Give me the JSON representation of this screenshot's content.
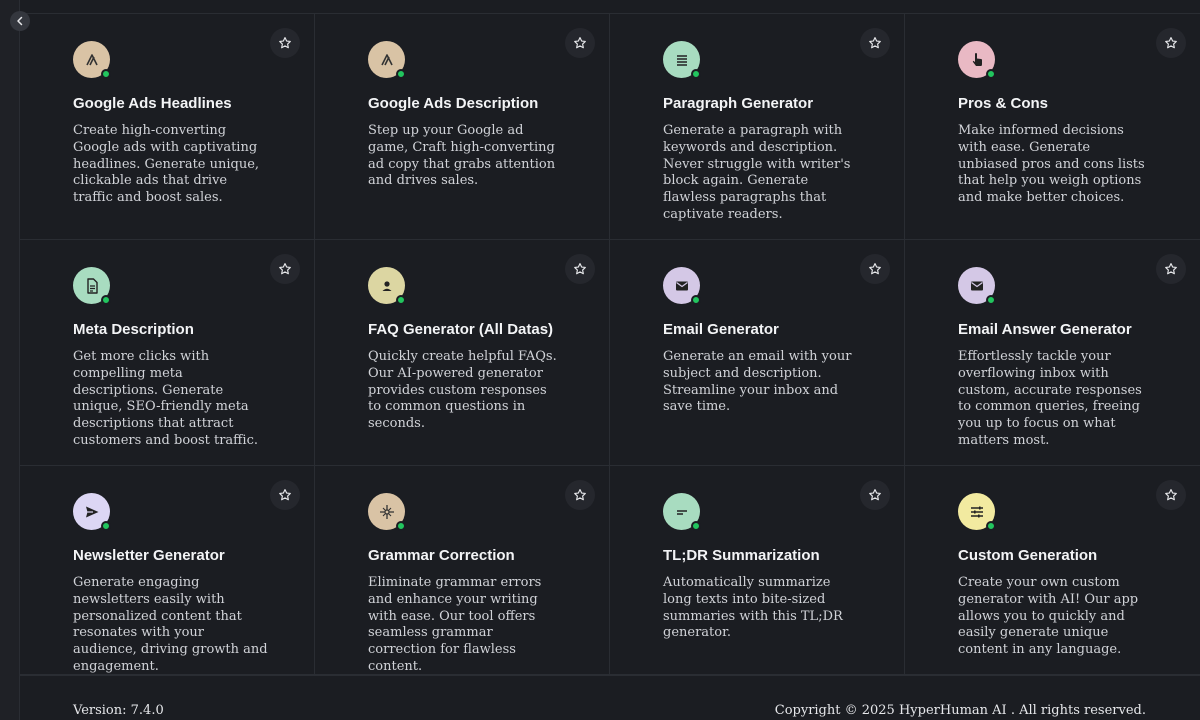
{
  "cards": [
    {
      "title": "Google Ads Headlines",
      "description": "Create high-converting Google ads with captivating headlines. Generate unique, clickable ads that drive traffic and boost sales.",
      "icon": "google-ads-icon",
      "icon_bg": "#d9c3a5"
    },
    {
      "title": "Google Ads Description",
      "description": "Step up your Google ad game, Craft high-converting ad copy that grabs attention and drives sales.",
      "icon": "google-ads-icon",
      "icon_bg": "#d9c3a5"
    },
    {
      "title": "Paragraph Generator",
      "description": "Generate a paragraph with keywords and description. Never struggle with writer's block again. Generate flawless paragraphs that captivate readers.",
      "icon": "paragraph-icon",
      "icon_bg": "#a8dcc0"
    },
    {
      "title": "Pros & Cons",
      "description": "Make informed decisions with ease. Generate unbiased pros and cons lists that help you weigh options and make better choices.",
      "icon": "pointer-hand-icon",
      "icon_bg": "#e9b9c4"
    },
    {
      "title": "Meta Description",
      "description": "Get more clicks with compelling meta descriptions. Generate unique, SEO-friendly meta descriptions that attract customers and boost traffic.",
      "icon": "document-icon",
      "icon_bg": "#a8dcc0"
    },
    {
      "title": "FAQ Generator (All Datas)",
      "description": "Quickly create helpful FAQs. Our AI-powered generator provides custom responses to common questions in seconds.",
      "icon": "person-icon",
      "icon_bg": "#dcd6a2"
    },
    {
      "title": "Email Generator",
      "description": "Generate an email with your subject and description. Streamline your inbox and save time.",
      "icon": "mail-icon",
      "icon_bg": "#d4c8e6"
    },
    {
      "title": "Email Answer Generator",
      "description": "Effortlessly tackle your overflowing inbox with custom, accurate responses to common queries, freeing you up to focus on what matters most.",
      "icon": "mail-icon",
      "icon_bg": "#d4c8e6"
    },
    {
      "title": "Newsletter Generator",
      "description": "Generate engaging newsletters easily with personalized content that resonates with your audience, driving growth and engagement.",
      "icon": "send-icon",
      "icon_bg": "#dcd6f4"
    },
    {
      "title": "Grammar Correction",
      "description": "Eliminate grammar errors and enhance your writing with ease. Our tool offers seamless grammar correction for flawless content.",
      "icon": "sparkle-icon",
      "icon_bg": "#d9c3a5"
    },
    {
      "title": "TL;DR Summarization",
      "description": "Automatically summarize long texts into bite-sized summaries with this TL;DR generator.",
      "icon": "short-text-icon",
      "icon_bg": "#a8dcc0"
    },
    {
      "title": "Custom Generation",
      "description": "Create your own custom generator with AI! Our app allows you to quickly and easily generate unique content in any language.",
      "icon": "sliders-icon",
      "icon_bg": "#f2eaa0"
    }
  ],
  "footer": {
    "version": "Version: 7.4.0",
    "copyright": "Copyright © 2025 HyperHuman AI . All rights reserved."
  },
  "colors": {
    "background": "#1b1d22",
    "status_online": "#22c55e"
  }
}
